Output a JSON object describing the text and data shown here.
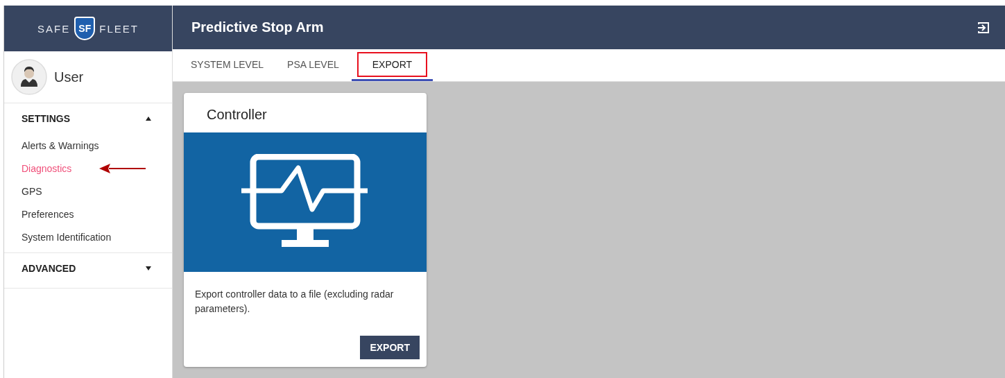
{
  "logo": {
    "left": "SAFE",
    "mark": "SF",
    "right": "FLEET"
  },
  "header": {
    "title": "Predictive Stop Arm"
  },
  "user": {
    "name": "User"
  },
  "sections": [
    {
      "label": "SETTINGS",
      "expanded": true,
      "items": [
        {
          "label": "Alerts & Warnings",
          "selected": false,
          "arrow": false
        },
        {
          "label": "Diagnostics",
          "selected": true,
          "arrow": true
        },
        {
          "label": "GPS",
          "selected": false,
          "arrow": false
        },
        {
          "label": "Preferences",
          "selected": false,
          "arrow": false
        },
        {
          "label": "System Identification",
          "selected": false,
          "arrow": false
        }
      ]
    },
    {
      "label": "ADVANCED",
      "expanded": false
    }
  ],
  "tabs": [
    {
      "label": "SYSTEM LEVEL",
      "selected": false,
      "highlighted": false
    },
    {
      "label": "PSA LEVEL",
      "selected": false,
      "highlighted": false
    },
    {
      "label": "EXPORT",
      "selected": true,
      "highlighted": true
    }
  ],
  "card": {
    "title": "Controller",
    "description": "Export controller data to a file (excluding radar parameters).",
    "button": "EXPORT"
  }
}
